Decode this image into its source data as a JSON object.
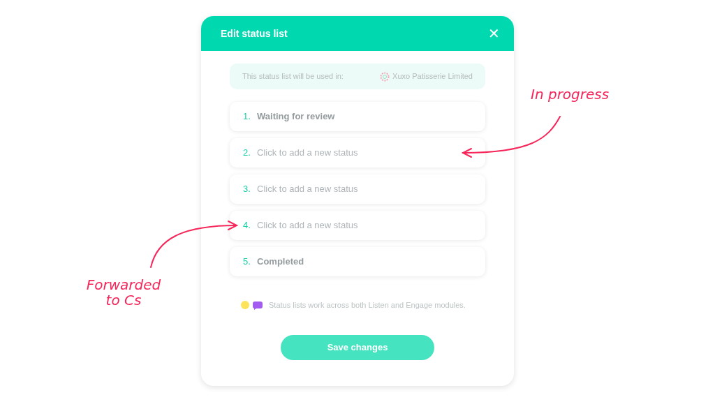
{
  "dialog": {
    "title": "Edit status list",
    "close": "✕"
  },
  "usage": {
    "label": "This status list will be used in:",
    "company": "Xuxo Patisserie Limited"
  },
  "statuses": [
    {
      "number": "1.",
      "text": "Waiting for review",
      "kind": "filled"
    },
    {
      "number": "2.",
      "text": "Click to add a new status",
      "kind": "placeholder"
    },
    {
      "number": "3.",
      "text": "Click to add a new status",
      "kind": "placeholder"
    },
    {
      "number": "4.",
      "text": "Click to add a new status",
      "kind": "placeholder"
    },
    {
      "number": "5.",
      "text": "Completed",
      "kind": "filled"
    }
  ],
  "note": "Status lists work across both Listen and Engage modules.",
  "save_button": "Save changes",
  "annotations": [
    {
      "text": "In progress"
    },
    {
      "text": "Forwarded to Cs"
    }
  ]
}
